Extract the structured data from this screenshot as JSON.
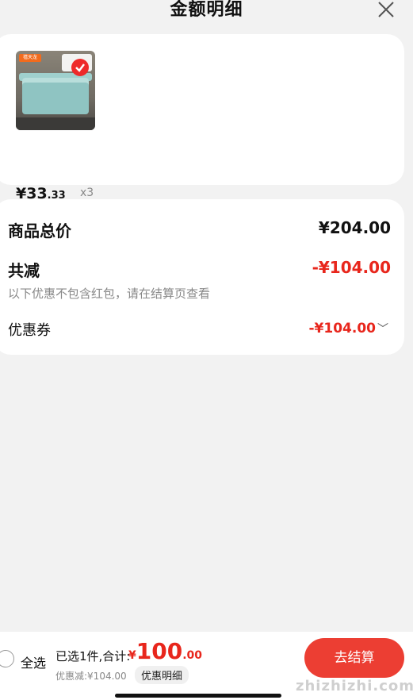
{
  "header": {
    "title": "金额明细"
  },
  "product": {
    "brand": "禧天龙",
    "price_main": "¥33",
    "price_decimal": ".33",
    "quantity": "x3"
  },
  "breakdown": {
    "subtotal_label": "商品总价",
    "subtotal_value": "¥204.00",
    "reduction_label": "共减",
    "reduction_value": "-¥104.00",
    "note": "以下优惠不包含红包，请在结算页查看",
    "coupon_label": "优惠券",
    "coupon_value": "-¥104.00"
  },
  "bottom": {
    "select_all": "全选",
    "summary": "已选1件,合计:",
    "total_currency": "¥",
    "total_int": "100",
    "total_dec": ".00",
    "discount": "优惠减:¥104.00",
    "detail_button": "优惠明细",
    "checkout_button": "去结算",
    "watermark": "zhizhizhi.com"
  },
  "colors": {
    "accent": "#e8261c",
    "checkout": "#ec3e33"
  }
}
